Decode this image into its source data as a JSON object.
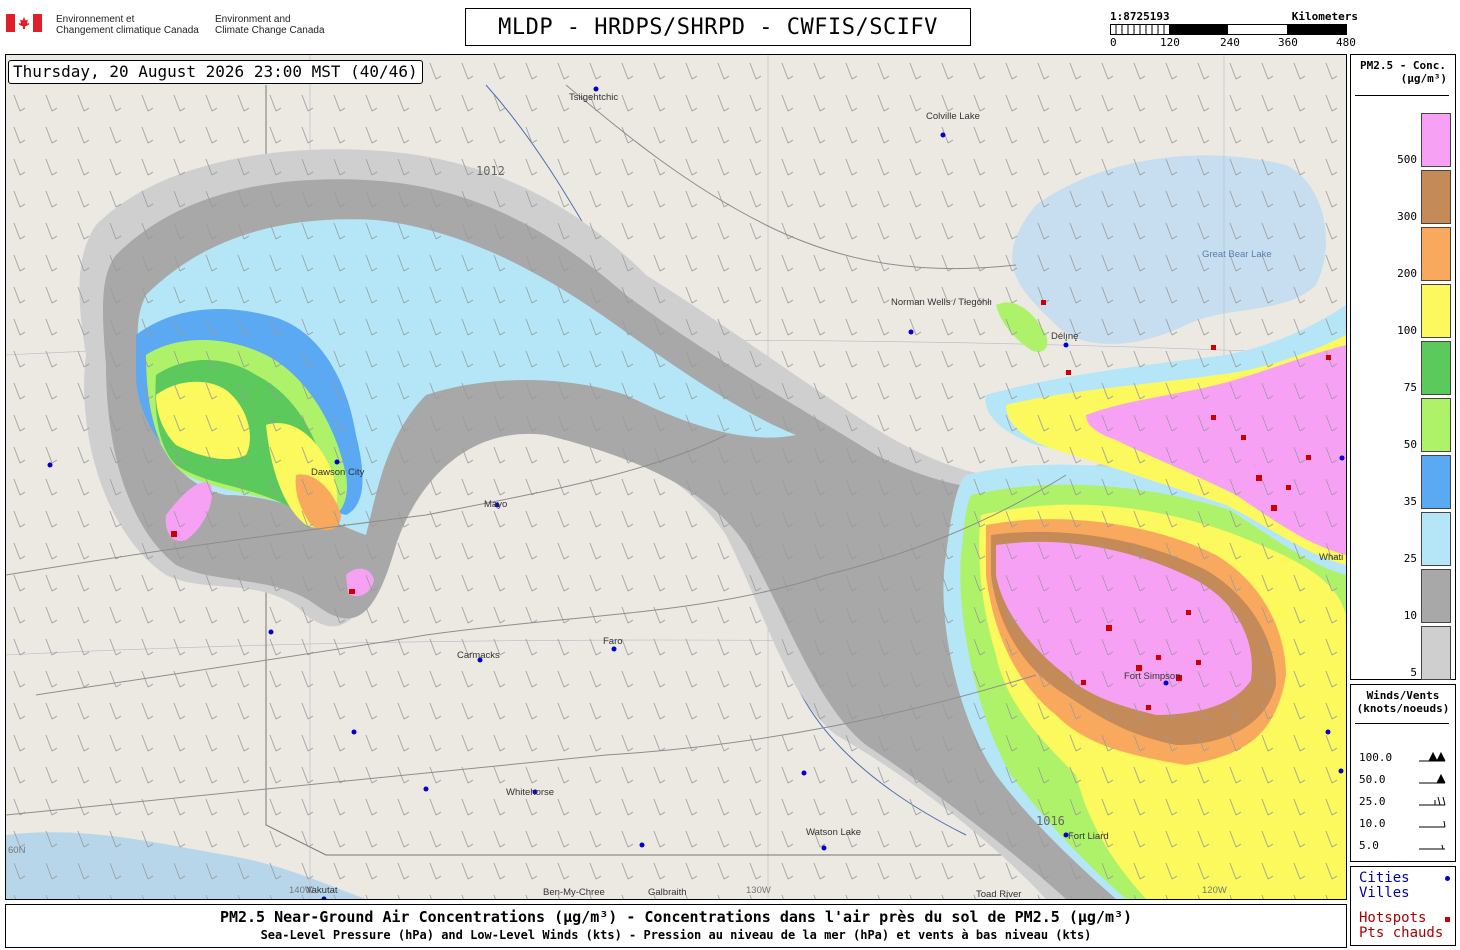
{
  "header": {
    "agency_fr_line1": "Environnement et",
    "agency_fr_line2": "Changement climatique Canada",
    "agency_en_line1": "Environment and",
    "agency_en_line2": "Climate Change Canada",
    "title": "MLDP - HRDPS/SHRPD - CWFIS/SCIFV"
  },
  "scale": {
    "ratio": "1:8725193",
    "unit": "Kilometers",
    "ticks": [
      "0",
      "120",
      "240",
      "360",
      "480"
    ]
  },
  "map": {
    "datetime": "Thursday, 20 August 2026 23:00 MST (40/46)",
    "cities": [
      {
        "name": "Tsiigehtchic"
      },
      {
        "name": "Colville Lake"
      },
      {
        "name": "Norman Wells / Tłegóhłı"
      },
      {
        "name": "Délı̨nę"
      },
      {
        "name": "Dawson City"
      },
      {
        "name": "Mayo"
      },
      {
        "name": "Faro"
      },
      {
        "name": "Carmacks"
      },
      {
        "name": "Whitehorse"
      },
      {
        "name": "Watson Lake"
      },
      {
        "name": "Fort Simpson"
      },
      {
        "name": "Yakutat"
      },
      {
        "name": "Ben-My-Chree"
      },
      {
        "name": "Galbraith"
      },
      {
        "name": "Toad River"
      },
      {
        "name": "Fort Liard"
      },
      {
        "name": "Whati"
      }
    ],
    "lake_label": "Great Bear Lake",
    "graticule_labels": [
      "140W",
      "130W",
      "120W",
      "60N"
    ],
    "isobar_values": [
      "1012",
      "1016"
    ]
  },
  "legend_conc": {
    "title_line1": "PM2.5 - Conc.",
    "title_line2": "(µg/m³)",
    "bins": [
      {
        "label": "500",
        "color": "#f7a1f4"
      },
      {
        "label": "300",
        "color": "#c48a58"
      },
      {
        "label": "200",
        "color": "#f9a95e"
      },
      {
        "label": "100",
        "color": "#fbf95e"
      },
      {
        "label": "75",
        "color": "#5bc95b"
      },
      {
        "label": "50",
        "color": "#aef26a"
      },
      {
        "label": "35",
        "color": "#5aa9f2"
      },
      {
        "label": "25",
        "color": "#b4e6f8"
      },
      {
        "label": "10",
        "color": "#a8a8a8"
      },
      {
        "label": "5",
        "color": "#cfcfcf"
      }
    ]
  },
  "legend_wind": {
    "title_line1": "Winds/Vents",
    "title_line2": "(knots/noeuds)",
    "rows": [
      "100.0",
      "50.0",
      "25.0",
      "10.0",
      "5.0"
    ]
  },
  "legend_points": {
    "cities_en": "Cities",
    "cities_fr": "Villes",
    "hotspots_en": "Hotspots",
    "hotspots_fr": "Pts chauds",
    "city_color": "#0000cc",
    "hotspot_color": "#cc0000"
  },
  "footer": {
    "line1": "PM2.5 Near-Ground Air Concentrations (µg/m³) - Concentrations dans l'air près du sol de PM2.5 (µg/m³)",
    "line2": "Sea-Level Pressure (hPa) and Low-Level Winds (kts) - Pression au niveau de la mer (hPa) et vents à bas niveau (kts)"
  }
}
